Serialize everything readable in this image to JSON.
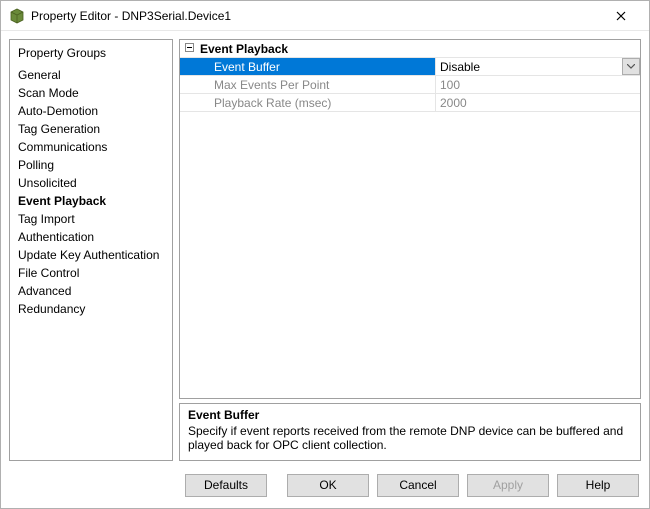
{
  "window": {
    "title": "Property Editor - DNP3Serial.Device1"
  },
  "sidebar": {
    "heading": "Property Groups",
    "items": [
      "General",
      "Scan Mode",
      "Auto-Demotion",
      "Tag Generation",
      "Communications",
      "Polling",
      "Unsolicited",
      "Event Playback",
      "Tag Import",
      "Authentication",
      "Update Key Authentication",
      "File Control",
      "Advanced",
      "Redundancy"
    ],
    "activeIndex": 7
  },
  "grid": {
    "category": "Event Playback",
    "rows": [
      {
        "name": "Event Buffer",
        "value": "Disable",
        "selected": true,
        "dropdown": true
      },
      {
        "name": "Max Events Per Point",
        "value": "100",
        "selected": false,
        "dropdown": false
      },
      {
        "name": "Playback Rate (msec)",
        "value": "2000",
        "selected": false,
        "dropdown": false
      }
    ]
  },
  "description": {
    "title": "Event Buffer",
    "body": "Specify if event reports received from the remote DNP device can be buffered and played back for OPC client collection."
  },
  "buttons": {
    "defaults": "Defaults",
    "ok": "OK",
    "cancel": "Cancel",
    "apply": "Apply",
    "help": "Help"
  }
}
